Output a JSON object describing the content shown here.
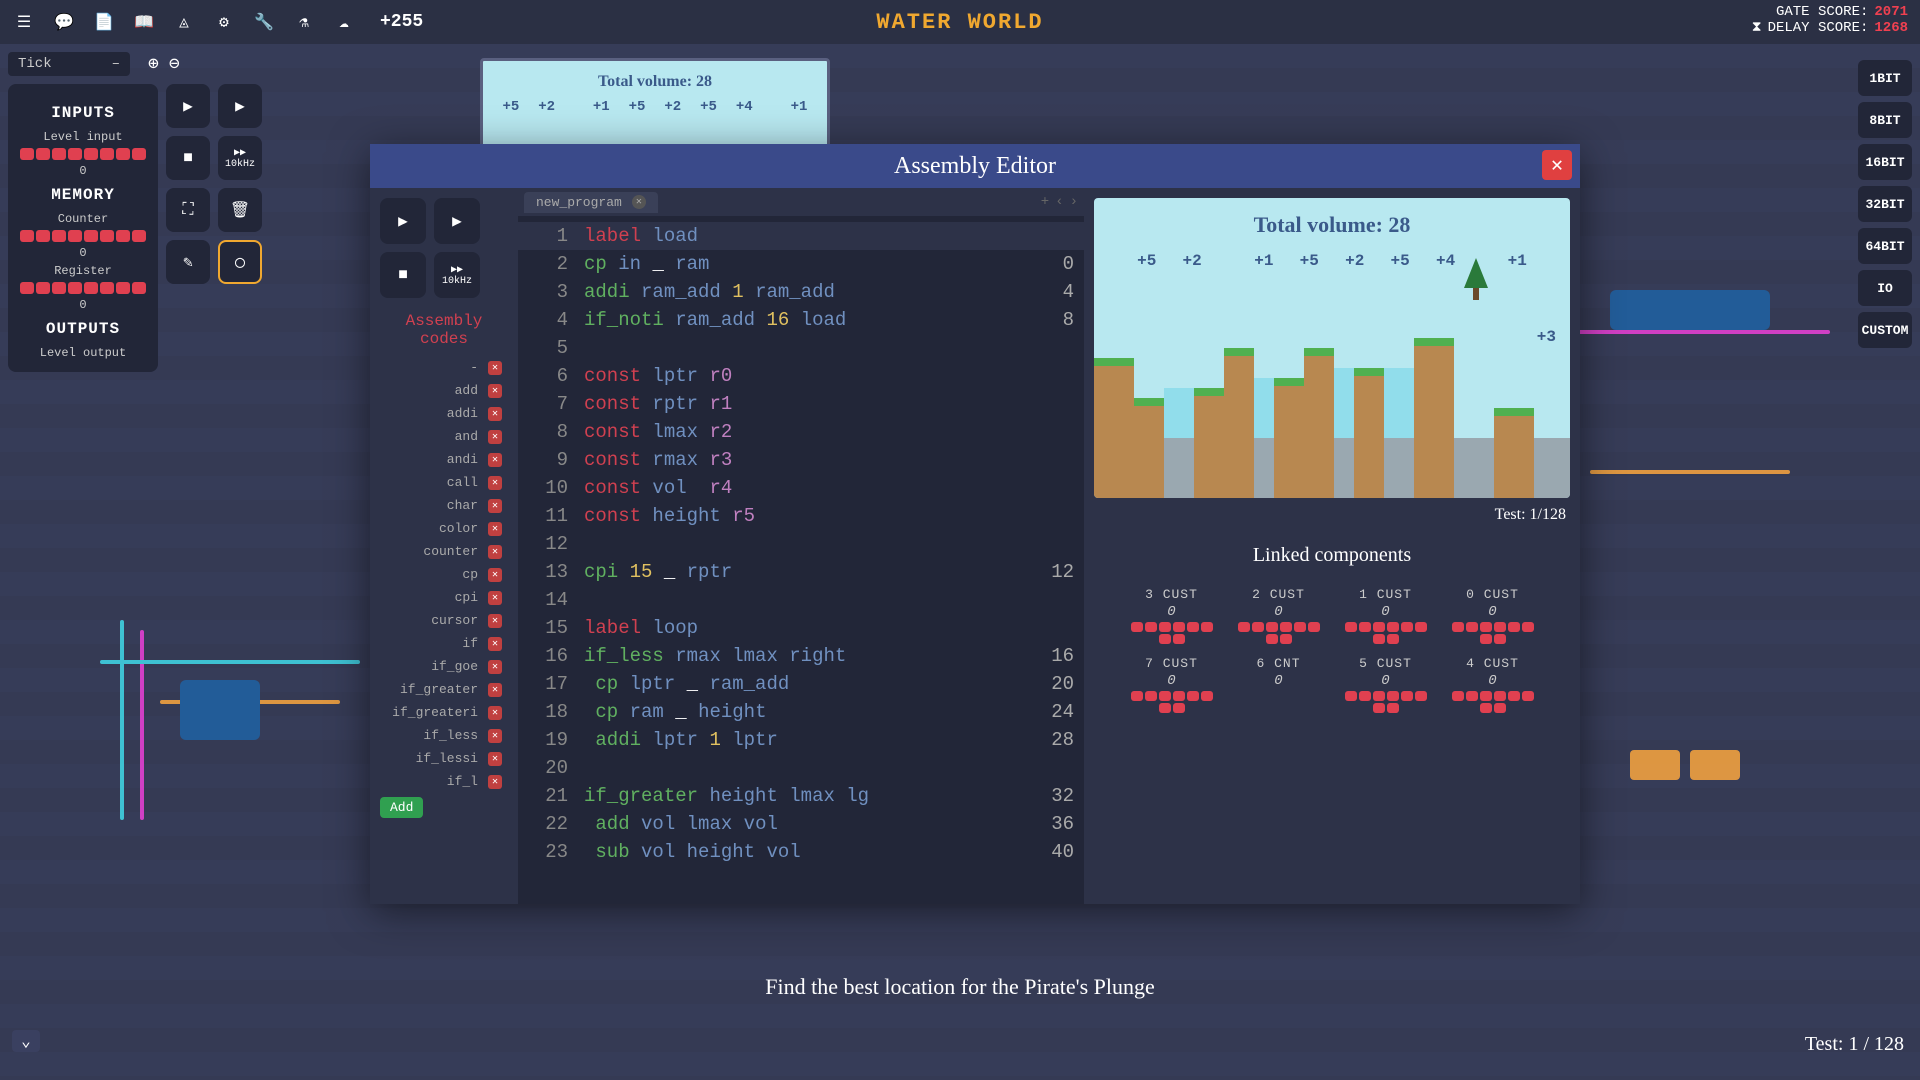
{
  "header": {
    "title": "WATER WORLD",
    "plus_count": "+255",
    "gate_score_label": "GATE SCORE:",
    "gate_score": "2071",
    "delay_score_label": "DELAY SCORE:",
    "delay_score": "1268"
  },
  "tick": {
    "label": "Tick",
    "dropdown": "–"
  },
  "left_panel": {
    "inputs_header": "INPUTS",
    "level_input_label": "Level input",
    "level_input_val": "0",
    "memory_header": "MEMORY",
    "counter_label": "Counter",
    "counter_val": "0",
    "register_label": "Register",
    "register_val": "0",
    "outputs_header": "OUTPUTS",
    "level_output_label": "Level output"
  },
  "sim_toolbar": {
    "khz_label": "10kHz"
  },
  "bit_buttons": [
    "1BIT",
    "8BIT",
    "16BIT",
    "32BIT",
    "64BIT",
    "IO",
    "CUSTOM"
  ],
  "mini_display": {
    "title": "Total volume: 28",
    "vals": [
      "+5",
      "+2",
      "",
      "+1",
      "+5",
      "+2",
      "+5",
      "+4",
      "",
      "+1"
    ]
  },
  "editor": {
    "title": "Assembly Editor",
    "tab_name": "new_program",
    "asm_codes_label": "Assembly codes",
    "asm_codes": [
      "-",
      "add",
      "addi",
      "and",
      "andi",
      "call",
      "char",
      "color",
      "counter",
      "cp",
      "cpi",
      "cursor",
      "if",
      "if_goe",
      "if_greater",
      "if_greateri",
      "if_less",
      "if_lessi",
      "if_l"
    ],
    "add_label": "Add",
    "code": [
      {
        "n": 1,
        "seg": [
          [
            "kw-label",
            "label"
          ],
          [
            "",
            " "
          ],
          [
            "kw-var",
            "load"
          ]
        ],
        "c": ""
      },
      {
        "n": 2,
        "seg": [
          [
            "kw-op",
            "cp"
          ],
          [
            "",
            " "
          ],
          [
            "kw-var",
            "in"
          ],
          [
            "",
            " "
          ],
          [
            "",
            "_"
          ],
          [
            "",
            " "
          ],
          [
            "kw-var",
            "ram"
          ]
        ],
        "c": "0"
      },
      {
        "n": 3,
        "seg": [
          [
            "kw-op",
            "addi"
          ],
          [
            "",
            " "
          ],
          [
            "kw-var",
            "ram_add"
          ],
          [
            "",
            " "
          ],
          [
            "kw-num",
            "1"
          ],
          [
            "",
            " "
          ],
          [
            "kw-var",
            "ram_add"
          ]
        ],
        "c": "4"
      },
      {
        "n": 4,
        "seg": [
          [
            "kw-op",
            "if_noti"
          ],
          [
            "",
            " "
          ],
          [
            "kw-var",
            "ram_add"
          ],
          [
            "",
            " "
          ],
          [
            "kw-num",
            "16"
          ],
          [
            "",
            " "
          ],
          [
            "kw-var",
            "load"
          ]
        ],
        "c": "8"
      },
      {
        "n": 5,
        "seg": [],
        "c": ""
      },
      {
        "n": 6,
        "seg": [
          [
            "kw-const",
            "const"
          ],
          [
            "",
            " "
          ],
          [
            "kw-var",
            "lptr"
          ],
          [
            "",
            " "
          ],
          [
            "kw-reg",
            "r0"
          ]
        ],
        "c": ""
      },
      {
        "n": 7,
        "seg": [
          [
            "kw-const",
            "const"
          ],
          [
            "",
            " "
          ],
          [
            "kw-var",
            "rptr"
          ],
          [
            "",
            " "
          ],
          [
            "kw-reg",
            "r1"
          ]
        ],
        "c": ""
      },
      {
        "n": 8,
        "seg": [
          [
            "kw-const",
            "const"
          ],
          [
            "",
            " "
          ],
          [
            "kw-var",
            "lmax"
          ],
          [
            "",
            " "
          ],
          [
            "kw-reg",
            "r2"
          ]
        ],
        "c": ""
      },
      {
        "n": 9,
        "seg": [
          [
            "kw-const",
            "const"
          ],
          [
            "",
            " "
          ],
          [
            "kw-var",
            "rmax"
          ],
          [
            "",
            " "
          ],
          [
            "kw-reg",
            "r3"
          ]
        ],
        "c": ""
      },
      {
        "n": 10,
        "seg": [
          [
            "kw-const",
            "const"
          ],
          [
            "",
            " "
          ],
          [
            "kw-var",
            "vol"
          ],
          [
            "",
            "  "
          ],
          [
            "kw-reg",
            "r4"
          ]
        ],
        "c": ""
      },
      {
        "n": 11,
        "seg": [
          [
            "kw-const",
            "const"
          ],
          [
            "",
            " "
          ],
          [
            "kw-var",
            "height"
          ],
          [
            "",
            " "
          ],
          [
            "kw-reg",
            "r5"
          ]
        ],
        "c": ""
      },
      {
        "n": 12,
        "seg": [],
        "c": ""
      },
      {
        "n": 13,
        "seg": [
          [
            "kw-op",
            "cpi"
          ],
          [
            "",
            " "
          ],
          [
            "kw-num",
            "15"
          ],
          [
            "",
            " "
          ],
          [
            "",
            "_"
          ],
          [
            "",
            " "
          ],
          [
            "kw-var",
            "rptr"
          ]
        ],
        "c": "12"
      },
      {
        "n": 14,
        "seg": [],
        "c": ""
      },
      {
        "n": 15,
        "seg": [
          [
            "kw-label",
            "label"
          ],
          [
            "",
            " "
          ],
          [
            "kw-var",
            "loop"
          ]
        ],
        "c": ""
      },
      {
        "n": 16,
        "seg": [
          [
            "kw-op",
            "if_less"
          ],
          [
            "",
            " "
          ],
          [
            "kw-var",
            "rmax"
          ],
          [
            "",
            " "
          ],
          [
            "kw-var",
            "lmax"
          ],
          [
            "",
            " "
          ],
          [
            "kw-var",
            "right"
          ]
        ],
        "c": "16"
      },
      {
        "n": 17,
        "seg": [
          [
            "",
            " "
          ],
          [
            "kw-op",
            "cp"
          ],
          [
            "",
            " "
          ],
          [
            "kw-var",
            "lptr"
          ],
          [
            "",
            " "
          ],
          [
            "",
            "_"
          ],
          [
            "",
            " "
          ],
          [
            "kw-var",
            "ram_add"
          ]
        ],
        "c": "20"
      },
      {
        "n": 18,
        "seg": [
          [
            "",
            " "
          ],
          [
            "kw-op",
            "cp"
          ],
          [
            "",
            " "
          ],
          [
            "kw-var",
            "ram"
          ],
          [
            "",
            " "
          ],
          [
            "",
            "_"
          ],
          [
            "",
            " "
          ],
          [
            "kw-var",
            "height"
          ]
        ],
        "c": "24"
      },
      {
        "n": 19,
        "seg": [
          [
            "",
            " "
          ],
          [
            "kw-op",
            "addi"
          ],
          [
            "",
            " "
          ],
          [
            "kw-var",
            "lptr"
          ],
          [
            "",
            " "
          ],
          [
            "kw-num",
            "1"
          ],
          [
            "",
            " "
          ],
          [
            "kw-var",
            "lptr"
          ]
        ],
        "c": "28"
      },
      {
        "n": 20,
        "seg": [],
        "c": ""
      },
      {
        "n": 21,
        "seg": [
          [
            "kw-op",
            "if_greater"
          ],
          [
            "",
            " "
          ],
          [
            "kw-var",
            "height"
          ],
          [
            "",
            " "
          ],
          [
            "kw-var",
            "lmax"
          ],
          [
            "",
            " "
          ],
          [
            "kw-var",
            "lg"
          ]
        ],
        "c": "32"
      },
      {
        "n": 22,
        "seg": [
          [
            "",
            " "
          ],
          [
            "kw-op",
            "add"
          ],
          [
            "",
            " "
          ],
          [
            "kw-var",
            "vol"
          ],
          [
            "",
            " "
          ],
          [
            "kw-var",
            "lmax"
          ],
          [
            "",
            " "
          ],
          [
            "kw-var",
            "vol"
          ]
        ],
        "c": "36"
      },
      {
        "n": 23,
        "seg": [
          [
            "",
            " "
          ],
          [
            "kw-op",
            "sub"
          ],
          [
            "",
            " "
          ],
          [
            "kw-var",
            "vol"
          ],
          [
            "",
            " "
          ],
          [
            "kw-var",
            "height"
          ],
          [
            "",
            " "
          ],
          [
            "kw-var",
            "vol"
          ]
        ],
        "c": "40"
      }
    ],
    "viz_title": "Total volume: 28",
    "viz_vals": [
      "+5",
      "+2",
      "",
      "+1",
      "+5",
      "+2",
      "+5",
      "+4",
      "",
      "+1"
    ],
    "viz_extra": "+3",
    "test_label": "Test: 1/128",
    "linked_header": "Linked components",
    "linked": [
      {
        "name": "3 CUST",
        "val": "0",
        "slots": 8
      },
      {
        "name": "2 CUST",
        "val": "0",
        "slots": 8
      },
      {
        "name": "1 CUST",
        "val": "0",
        "slots": 8
      },
      {
        "name": "0 CUST",
        "val": "0",
        "slots": 8
      },
      {
        "name": "7 CUST",
        "val": "0",
        "slots": 8
      },
      {
        "name": "6 CNT",
        "val": "0",
        "slots": 0
      },
      {
        "name": "5 CUST",
        "val": "0",
        "slots": 8
      },
      {
        "name": "4 CUST",
        "val": "0",
        "slots": 8
      }
    ]
  },
  "footer": {
    "instruction": "Find the best location for the Pirate's Plunge",
    "test": "Test: 1 / 128"
  }
}
